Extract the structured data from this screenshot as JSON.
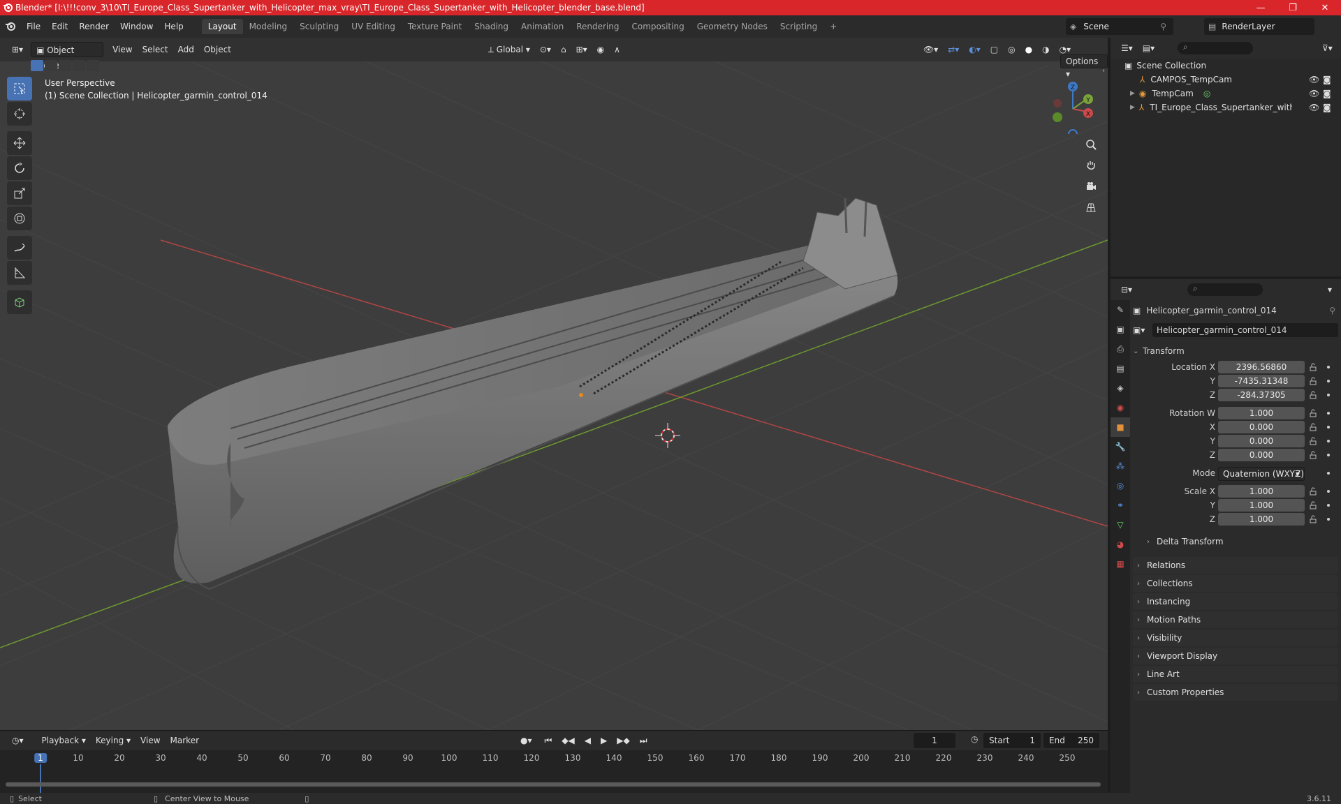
{
  "window": {
    "title": "Blender* [I:\\!!!conv_3\\10\\TI_Europe_Class_Supertanker_with_Helicopter_max_vray\\TI_Europe_Class_Supertanker_with_Helicopter_blender_base.blend]",
    "minimize": "—",
    "restore": "❐",
    "close": "✕"
  },
  "menu": [
    "File",
    "Edit",
    "Render",
    "Window",
    "Help"
  ],
  "workspaces": [
    "Layout",
    "Modeling",
    "Sculpting",
    "UV Editing",
    "Texture Paint",
    "Shading",
    "Animation",
    "Rendering",
    "Compositing",
    "Geometry Nodes",
    "Scripting"
  ],
  "add_workspace": "+",
  "scene": {
    "name": "Scene",
    "view_layer": "RenderLayer"
  },
  "viewport": {
    "mode": "Object Mode",
    "menus": [
      "View",
      "Select",
      "Add",
      "Object"
    ],
    "orientation": "Global",
    "options_label": "Options",
    "perspective": "User Perspective",
    "collection_info": "(1) Scene Collection | Helicopter_garmin_control_014",
    "axes": {
      "x": "X",
      "y": "Y",
      "z": "Z"
    },
    "colors": {
      "x_axis": "#c84a4a",
      "y_axis": "#7aa33a",
      "z_axis": "#3e79c7",
      "grid_bg": "#3d3d3d",
      "accent": "#4772b3"
    }
  },
  "timeline": {
    "menus": [
      "Playback",
      "Keying",
      "View",
      "Marker"
    ],
    "current_frame": "1",
    "start_label": "Start",
    "start": "1",
    "end_label": "End",
    "end": "250",
    "ticks": [
      "1",
      "10",
      "20",
      "30",
      "40",
      "50",
      "60",
      "70",
      "80",
      "90",
      "100",
      "110",
      "120",
      "130",
      "140",
      "150",
      "160",
      "170",
      "180",
      "190",
      "200",
      "210",
      "220",
      "230",
      "240",
      "250"
    ]
  },
  "statusbar": {
    "select": "Select",
    "center_view": "Center View to Mouse",
    "version": "3.6.11"
  },
  "outliner": {
    "root": "Scene Collection",
    "items": [
      {
        "name": "CAMPOS_TempCam",
        "expandable": false
      },
      {
        "name": "TempCam",
        "expandable": true
      },
      {
        "name": "TI_Europe_Class_Supertanker_with_Heli",
        "expandable": true
      }
    ]
  },
  "properties": {
    "object_name": "Helicopter_garmin_control_014",
    "data_name": "Helicopter_garmin_control_014",
    "transform_label": "Transform",
    "location": {
      "label": "Location X",
      "x": "2396.56860",
      "y_label": "Y",
      "y": "-7435.31348",
      "z_label": "Z",
      "z": "-284.37305"
    },
    "rotation": {
      "label": "Rotation W",
      "w": "1.000",
      "x_label": "X",
      "x": "0.000",
      "y_label": "Y",
      "y": "0.000",
      "z_label": "Z",
      "z": "0.000"
    },
    "mode": {
      "label": "Mode",
      "value": "Quaternion (WXYZ)"
    },
    "scale": {
      "label": "Scale X",
      "x": "1.000",
      "y_label": "Y",
      "y": "1.000",
      "z_label": "Z",
      "z": "1.000"
    },
    "delta_transform": "Delta Transform",
    "panels": [
      "Relations",
      "Collections",
      "Instancing",
      "Motion Paths",
      "Visibility",
      "Viewport Display",
      "Line Art",
      "Custom Properties"
    ]
  }
}
